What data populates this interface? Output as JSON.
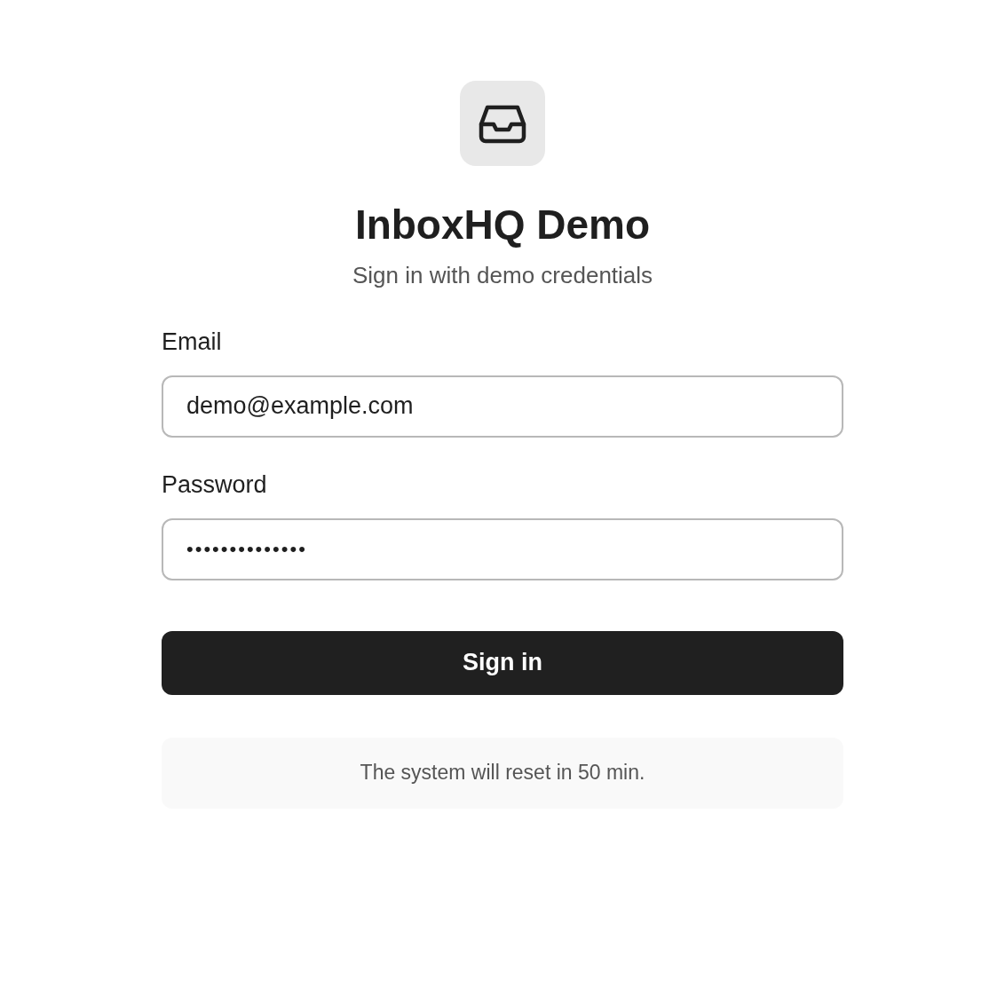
{
  "app": {
    "title": "InboxHQ Demo",
    "subtitle": "Sign in with demo credentials"
  },
  "form": {
    "fields": [
      {
        "kind": "text",
        "label": "Email",
        "value": "demo@example.com"
      },
      {
        "kind": "password",
        "label": "Password",
        "value": "••••••••••••••"
      }
    ],
    "submit": "Sign in"
  },
  "notice": "The system will reset in 50 min."
}
